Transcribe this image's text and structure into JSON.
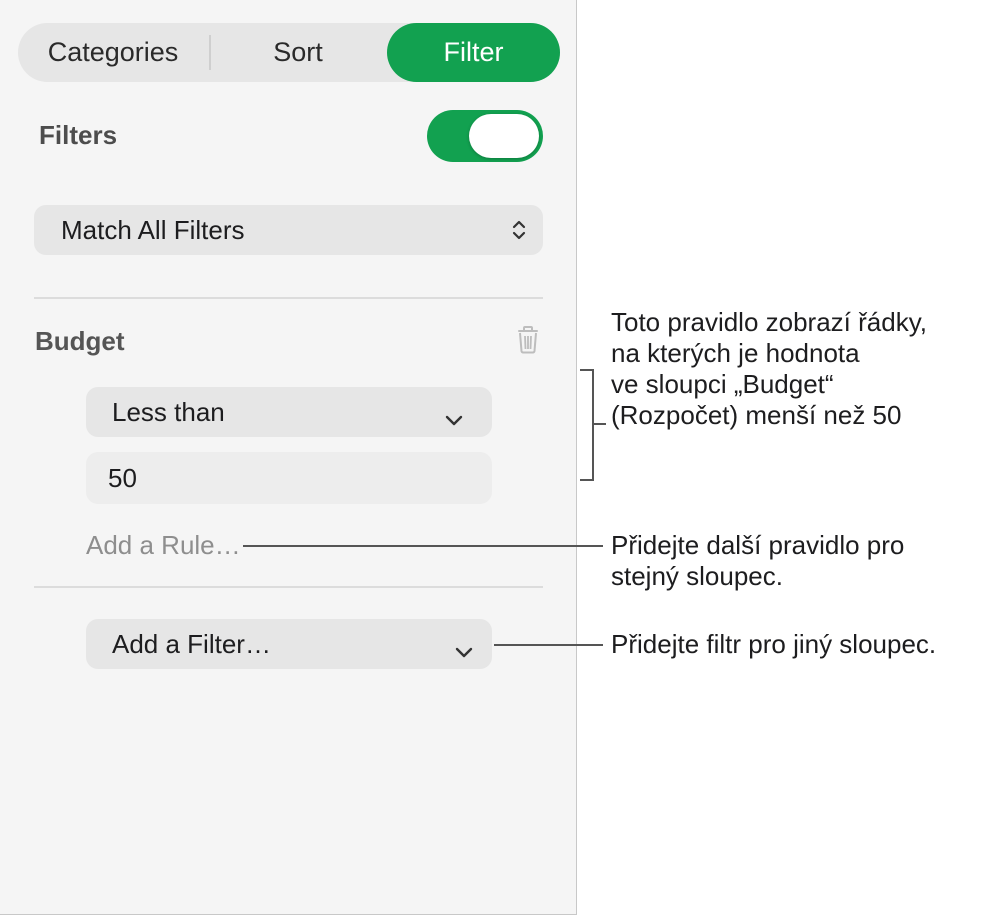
{
  "tabs": {
    "categories": "Categories",
    "sort": "Sort",
    "filter": "Filter",
    "active": "Filter"
  },
  "filters": {
    "heading": "Filters",
    "toggle_on": true,
    "match_select": "Match All Filters"
  },
  "budget": {
    "column": "Budget",
    "condition": "Less than",
    "value": "50",
    "add_rule": "Add a Rule…"
  },
  "add_filter": "Add a Filter…",
  "annotations": {
    "rule_lines": [
      "Toto pravidlo zobrazí řádky,",
      "na kterých je hodnota",
      "ve sloupci „Budget“",
      "(Rozpočet) menší než 50"
    ],
    "add_rule_lines": [
      "Přidejte další pravidlo pro",
      "stejný sloupec."
    ],
    "add_filter_line": "Přidejte filtr pro jiný sloupec."
  },
  "colors": {
    "accent": "#12a150",
    "panel_bg": "#f5f5f5",
    "control_bg": "#e6e6e6",
    "muted_text": "#8e8e8e"
  },
  "icons": {
    "match_select": "chevron-up-down-icon",
    "condition_select": "chevron-down-icon",
    "delete": "trash-icon",
    "add_filter_select": "chevron-down-icon"
  }
}
